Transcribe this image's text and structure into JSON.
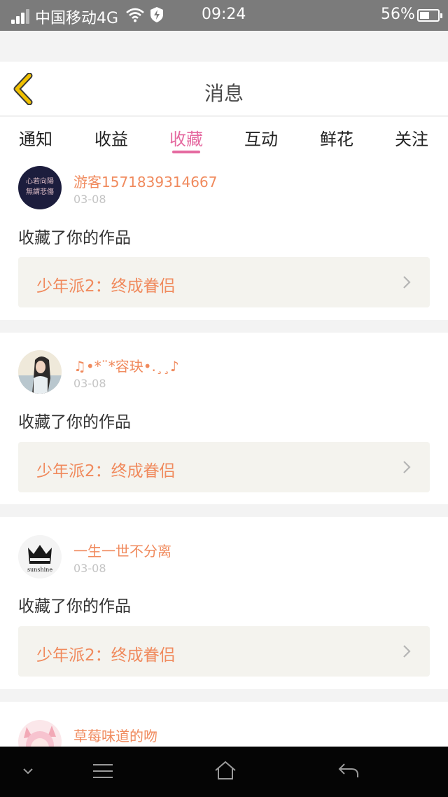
{
  "status_bar": {
    "carrier": "中国移动4G",
    "time": "09:24",
    "battery_percent": "56%",
    "battery_level": 0.56,
    "icons": [
      "signal-icon",
      "wifi-icon",
      "shield-icon",
      "battery-icon"
    ]
  },
  "header": {
    "title": "消息",
    "back_icon": "chevron-left-icon"
  },
  "tabs": [
    {
      "label": "通知",
      "active": false
    },
    {
      "label": "收益",
      "active": false
    },
    {
      "label": "收藏",
      "active": true
    },
    {
      "label": "互动",
      "active": false
    },
    {
      "label": "鲜花",
      "active": false
    },
    {
      "label": "关注",
      "active": false
    }
  ],
  "colors": {
    "accent": "#e56aa0",
    "username": "#f08a5d",
    "back_icon": "#f0c000",
    "work_bg": "#f4f3ee"
  },
  "messages": [
    {
      "username": "游客1571839314667",
      "date": "03-08",
      "action": "收藏了你的作品",
      "work_title": "少年派2：终成眷侣",
      "avatar_text": [
        "心若向陽",
        "無謂悲傷"
      ]
    },
    {
      "username": "♫•*¨*容玦•.¸¸♪",
      "date": "03-08",
      "action": "收藏了你的作品",
      "work_title": "少年派2：终成眷侣"
    },
    {
      "username": "一生一世不分离",
      "date": "03-08",
      "action": "收藏了你的作品",
      "work_title": "少年派2：终成眷侣",
      "avatar_text": [
        "sunshine"
      ]
    },
    {
      "username": "草莓味道的吻"
    }
  ],
  "navbar": {
    "icons": [
      "chevron-down-icon",
      "menu-icon",
      "home-icon",
      "back-arrow-icon"
    ]
  }
}
